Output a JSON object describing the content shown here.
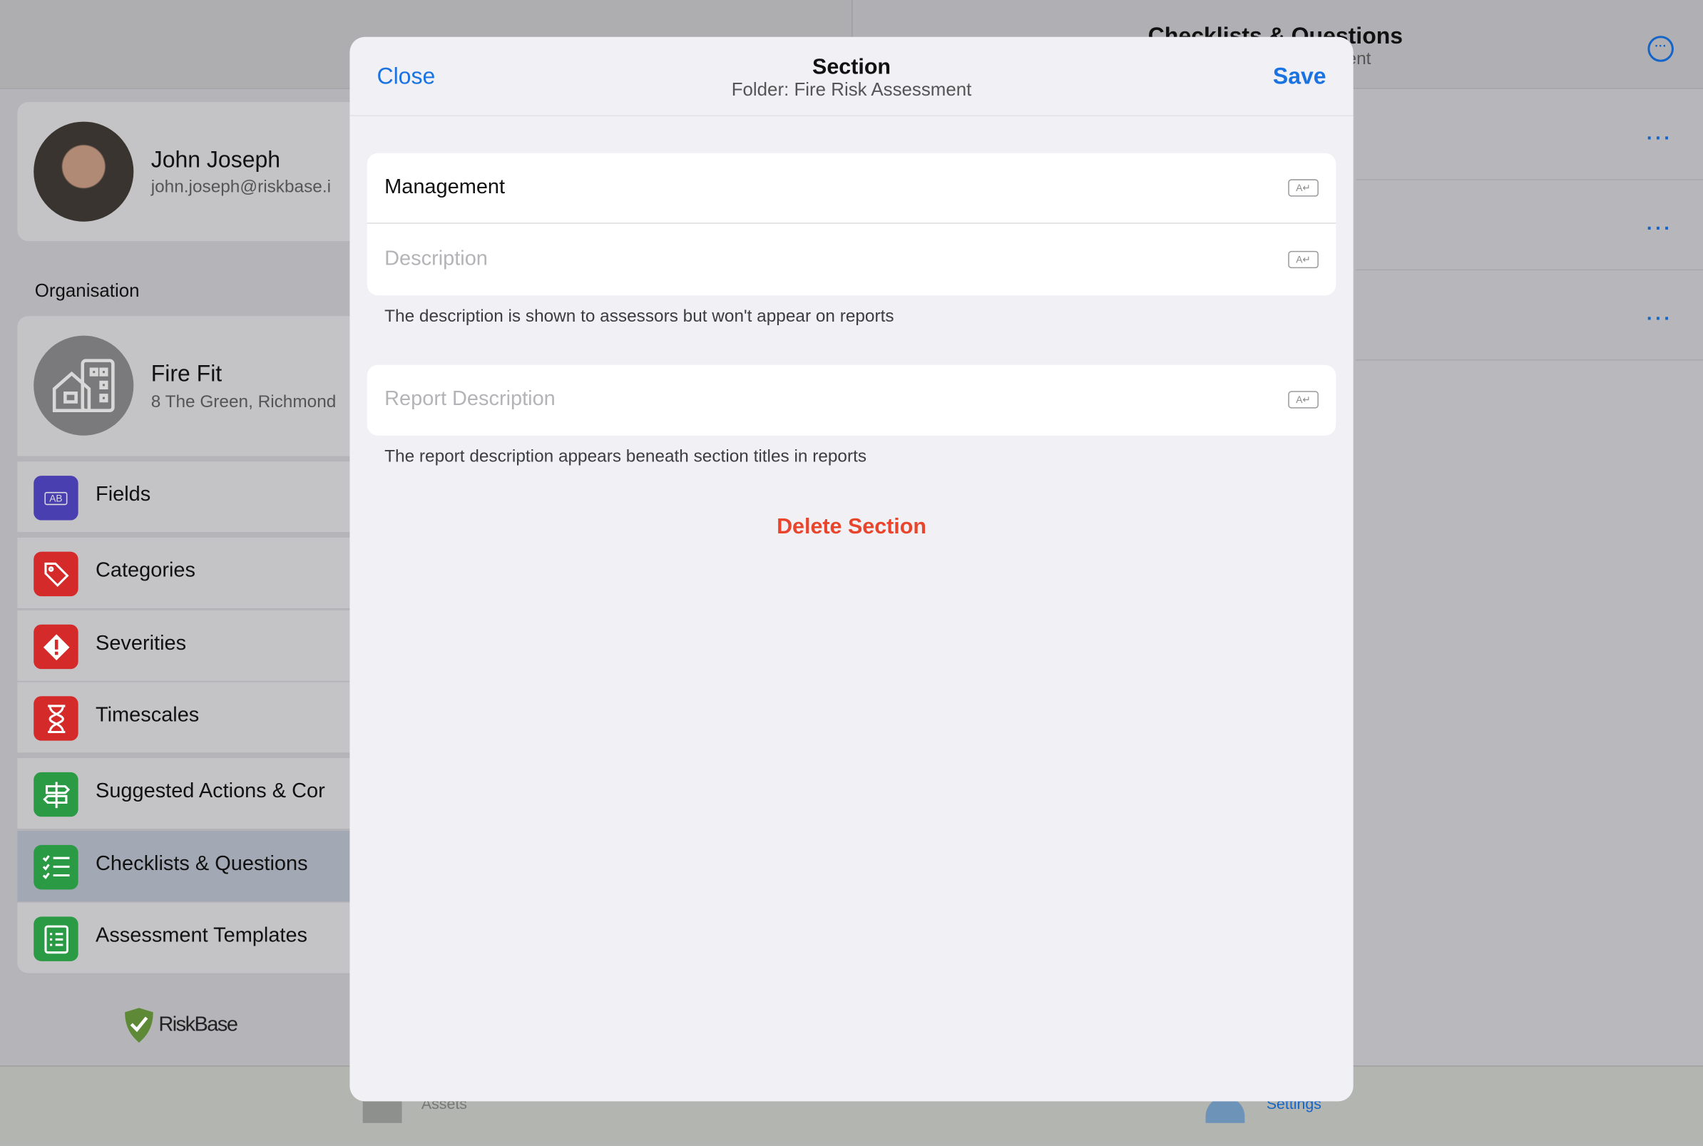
{
  "profile": {
    "name": "John Joseph",
    "email": "john.joseph@riskbase.i"
  },
  "organisation": {
    "heading": "Organisation",
    "name": "Fire Fit",
    "address": "8 The Green, Richmond"
  },
  "menu": [
    {
      "label": "Fields",
      "icon": "fields-icon",
      "color": "#4a3fb0"
    },
    {
      "label": "Categories",
      "icon": "tag-icon",
      "color": "#d42a2a"
    },
    {
      "label": "Severities",
      "icon": "warning-diamond-icon",
      "color": "#d42a2a"
    },
    {
      "label": "Timescales",
      "icon": "hourglass-icon",
      "color": "#d42a2a"
    },
    {
      "label": "Suggested Actions & Cor",
      "icon": "signpost-icon",
      "color": "#2a9a45"
    },
    {
      "label": "Checklists & Questions",
      "icon": "checklist-icon",
      "color": "#2a9a45",
      "selected": true
    },
    {
      "label": "Assessment Templates",
      "icon": "template-icon",
      "color": "#2a9a45"
    }
  ],
  "logo": {
    "text": "RiskBase"
  },
  "right_panel": {
    "title": "Checklists & Questions",
    "subtitle": "ent",
    "more_icon": "ellipsis-circle-icon",
    "rows": 3
  },
  "tabbar": {
    "items": [
      {
        "label": "Assets",
        "icon": "assets-icon"
      },
      {
        "label": "Settings",
        "icon": "settings-icon",
        "active": true
      }
    ]
  },
  "modal": {
    "close_label": "Close",
    "save_label": "Save",
    "title": "Section",
    "subtitle": "Folder: Fire Risk Assessment",
    "name_value": "Management",
    "description_placeholder": "Description",
    "description_note": "The description is shown to assessors but won't appear on reports",
    "report_description_placeholder": "Report Description",
    "report_description_note": "The report description appears beneath section titles in reports",
    "delete_label": "Delete Section",
    "accent": "#1a73e0",
    "danger": "#e8452c",
    "keyboard_glyph": "A↵"
  }
}
